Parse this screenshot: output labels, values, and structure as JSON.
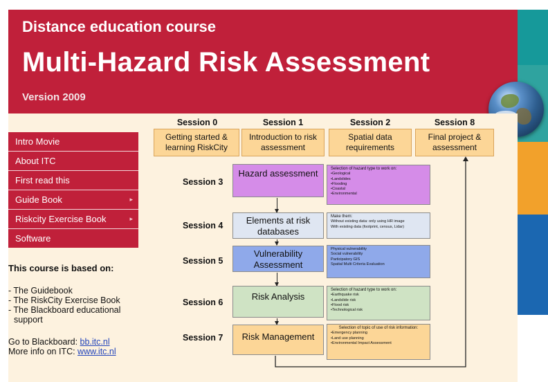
{
  "header": {
    "line1": "Distance education course",
    "line2": "Multi-Hazard Risk Assessment",
    "line3": "Version 2009"
  },
  "menu": {
    "items": [
      {
        "label": "Intro Movie",
        "submenu": false
      },
      {
        "label": "About ITC",
        "submenu": false
      },
      {
        "label": "First read this",
        "submenu": false
      },
      {
        "label": "Guide Book",
        "submenu": true
      },
      {
        "label": "Riskcity Exercise Book",
        "submenu": true
      },
      {
        "label": "Software",
        "submenu": false
      }
    ],
    "submenu_arrow": "▸"
  },
  "sidebar": {
    "based_on_title": "This course is based on:",
    "based_on_items": [
      "- The Guidebook",
      "- The RiskCity Exercise Book",
      "- The Blackboard educational",
      "  support"
    ],
    "blackboard_prefix": "Go to Blackboard: ",
    "blackboard_link": "bb.itc.nl",
    "itc_prefix": "More info on ITC: ",
    "itc_link": "www.itc.nl"
  },
  "diagram": {
    "top_sessions": [
      {
        "session": "Session 0",
        "label": "Getting started & learning RiskCity"
      },
      {
        "session": "Session 1",
        "label": "Introduction to risk assessment"
      },
      {
        "session": "Session 2",
        "label": "Spatial data requirements"
      },
      {
        "session": "Session 8",
        "label": "Final project & assessment"
      }
    ],
    "rows": [
      {
        "session": "Session 3",
        "step": "Hazard assessment",
        "info_title": "Selection of hazard type to work on:",
        "info_items": [
          "•Geological",
          "•Landslides",
          "•Flooding",
          "•Coastal",
          "•Environmental"
        ]
      },
      {
        "session": "Session 4",
        "step": "Elements at risk databases",
        "info_title": "Make them:",
        "info_items": [
          "Without existing data: only using HR image",
          "With existing data (footprint, census, Lidar)"
        ]
      },
      {
        "session": "Session 5",
        "step": "Vulnerability Assessment",
        "info_title": "",
        "info_items": [
          "Physical vulnerability",
          "Social vulnerability",
          "Participatory GIS",
          "Spatial Multi Criteria Evaluation"
        ]
      },
      {
        "session": "Session 6",
        "step": "Risk Analysis",
        "info_title": "Selection of hazard type to work on:",
        "info_items": [
          "•Earthquake risk",
          "•Landslide risk",
          "•Flood risk",
          "•Technological risk"
        ]
      },
      {
        "session": "Session 7",
        "step": "Risk Management",
        "info_title": "Selection of topic of use of risk information:",
        "info_items": [
          "•Emergency planning",
          "•Land use planning",
          "•Environmental Impact Assessment"
        ]
      }
    ]
  },
  "colors": {
    "brand_red": "#c0203a",
    "cream": "#fdf2df",
    "orange_box": "#fcd697",
    "hazard": "#d58ce8",
    "elements": "#dfe6f2",
    "vulnerability": "#8fa9ea",
    "risk_analysis": "#cfe3c4",
    "risk_management": "#fcd697",
    "teal": "#16999a",
    "orange": "#f2a12b",
    "blue": "#1b67b1"
  }
}
